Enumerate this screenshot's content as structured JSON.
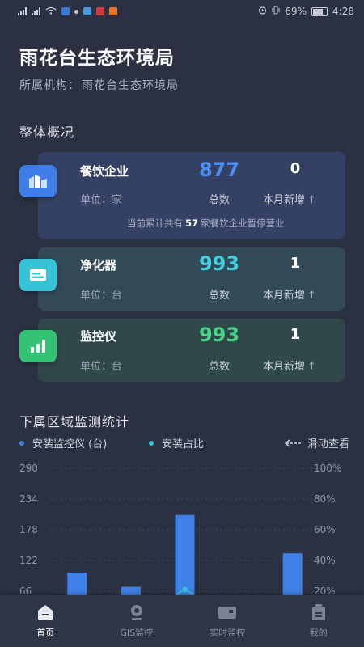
{
  "status_bar": {
    "battery": "69%",
    "time": "4:28"
  },
  "header": {
    "title": "雨花台生态环境局",
    "org_label": "所属机构：",
    "org_name": "雨花台生态环境局"
  },
  "overview": {
    "title": "整体概况",
    "cards": [
      {
        "name": "餐饮企业",
        "unit": "单位：家",
        "total": "877",
        "total_label": "总数",
        "new": "0",
        "new_label": "本月新增",
        "total_color": "#4d8ff0",
        "note_prefix": "当前累计共有",
        "note_count": "57",
        "note_suffix": "家餐饮企业暂停营业"
      },
      {
        "name": "净化器",
        "unit": "单位：台",
        "total": "993",
        "total_label": "总数",
        "new": "1",
        "new_label": "本月新增",
        "total_color": "#3fd0e0"
      },
      {
        "name": "监控仪",
        "unit": "单位：台",
        "total": "993",
        "total_label": "总数",
        "new": "1",
        "new_label": "本月新增",
        "total_color": "#45d486"
      }
    ]
  },
  "stats": {
    "title": "下属区域监测统计",
    "legend_installed": "安装监控仪 (台)",
    "legend_ratio": "安装占比",
    "swipe_hint": "滑动查看",
    "colors": {
      "bar": "#3f80e6",
      "ratio": "#35c3d6"
    }
  },
  "chart_data": {
    "type": "bar",
    "left_ticks": [
      "290",
      "234",
      "178",
      "122",
      "66"
    ],
    "right_ticks": [
      "100%",
      "80%",
      "60%",
      "40%",
      "20%"
    ],
    "ylim_left": [
      10,
      290
    ],
    "ylim_right": [
      0,
      100
    ],
    "values": [
      100,
      74,
      205,
      45,
      135
    ],
    "ratio_values": [
      null,
      null,
      20,
      null,
      null
    ]
  },
  "tabbar": {
    "tabs": [
      {
        "label": "首页",
        "icon": "home-icon"
      },
      {
        "label": "GIS监控",
        "icon": "map-pin-icon"
      },
      {
        "label": "实时监控",
        "icon": "video-monitor-icon"
      },
      {
        "label": "我的",
        "icon": "profile-icon"
      }
    ]
  }
}
